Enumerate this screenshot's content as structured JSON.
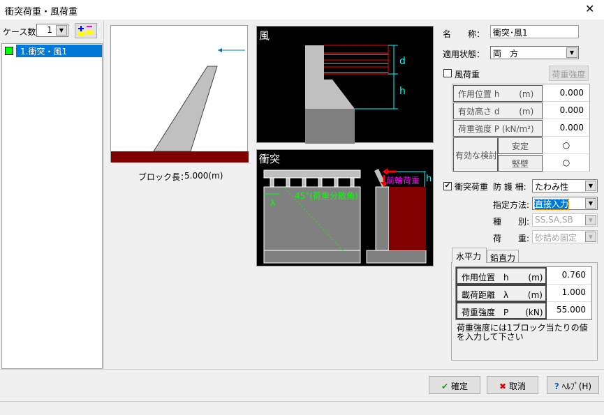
{
  "window": {
    "title": "衝突荷重・風荷重",
    "close": "✕"
  },
  "left": {
    "case_count_label": "ケース数:",
    "case_count": "1",
    "cases": [
      {
        "label": "1.衝突・風1",
        "color": "#00ff00"
      }
    ]
  },
  "preview": {
    "block_length_label": "ブロック長：",
    "block_length": "5.000(m)"
  },
  "wind_diagram": {
    "title": "風",
    "d": "d",
    "h": "h"
  },
  "collision_diagram": {
    "title": "衝突",
    "angle_label": "45°(荷重分散角)",
    "lambda": "λ",
    "front_wheel_label": "前輪荷重",
    "h": "h"
  },
  "form": {
    "name_label": "名　　称：",
    "name_value": "衝突･風1",
    "state_label": "適用状態：",
    "state_value": "両　方",
    "wind_label": "風荷重",
    "wind_checked": false,
    "load_strength_button": "荷重強度",
    "wind_table": [
      {
        "label": "作用位置 h　　 (m)",
        "value": "0.000"
      },
      {
        "label": "有効高さ d　　 (m)",
        "value": "0.000"
      },
      {
        "label": "荷重強度 P (kN/m²)",
        "value": "0.000"
      }
    ],
    "effective_check_label": "有効な検討",
    "checks": [
      {
        "label": "安定",
        "value": "○"
      },
      {
        "label": "竪壁",
        "value": "○"
      }
    ],
    "collision_label": "衝突荷重",
    "collision_checked": true,
    "guard_label": "防 護 柵:",
    "guard_value": "たわみ性",
    "method_label": "指定方法:",
    "method_value": "直接入力",
    "type_label": "種　　別:",
    "type_value": "SS,SA,SB",
    "load_label": "荷　　重:",
    "load_value": "砂詰め固定",
    "tabs": [
      "水平力",
      "鉛直力"
    ],
    "collision_table": [
      {
        "label": "作用位置　h　　 (m)",
        "value": "0.760"
      },
      {
        "label": "載荷距離　λ　　 (m)",
        "value": "1.000"
      },
      {
        "label": "荷重強度　P　　(kN)",
        "value": "55.000"
      }
    ],
    "note": "荷重強度には1ブロック当たりの値を入力して下さい"
  },
  "buttons": {
    "ok": "確定",
    "cancel": "取消",
    "help": "ﾍﾙﾌﾟ(H)"
  }
}
